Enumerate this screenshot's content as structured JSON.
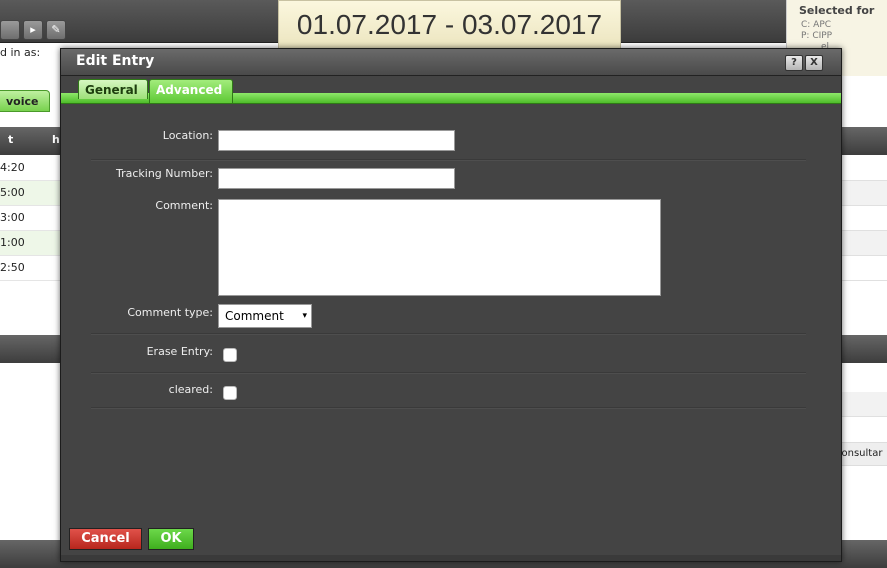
{
  "background": {
    "login_text": "d in as:",
    "date_range": "01.07.2017 - 03.07.2017",
    "selected_title": "Selected for",
    "selected_lines": [
      "C: APC",
      "P: CIPP",
      "el"
    ],
    "tab_label": "voice",
    "header_cols": [
      "t",
      "h"
    ],
    "times": [
      "4:20",
      "5:00",
      "3:00",
      "1:00",
      "2:50"
    ],
    "consult_text": "consultar"
  },
  "dialog": {
    "title": "Edit Entry",
    "help_label": "?",
    "close_label": "X",
    "tabs": [
      {
        "label": "General",
        "active": false
      },
      {
        "label": "Advanced",
        "active": true
      }
    ],
    "fields": {
      "location_label": "Location:",
      "location_value": "",
      "tracking_label": "Tracking Number:",
      "tracking_value": "",
      "comment_label": "Comment:",
      "comment_value": "",
      "comment_type_label": "Comment type:",
      "comment_type_value": "Comment",
      "erase_label": "Erase Entry:",
      "erase_checked": false,
      "cleared_label": "cleared:",
      "cleared_checked": false
    },
    "buttons": {
      "cancel": "Cancel",
      "ok": "OK"
    }
  },
  "colors": {
    "accent_green": "#5dc934",
    "cancel_red": "#b7261d",
    "dialog_bg": "#444444"
  }
}
